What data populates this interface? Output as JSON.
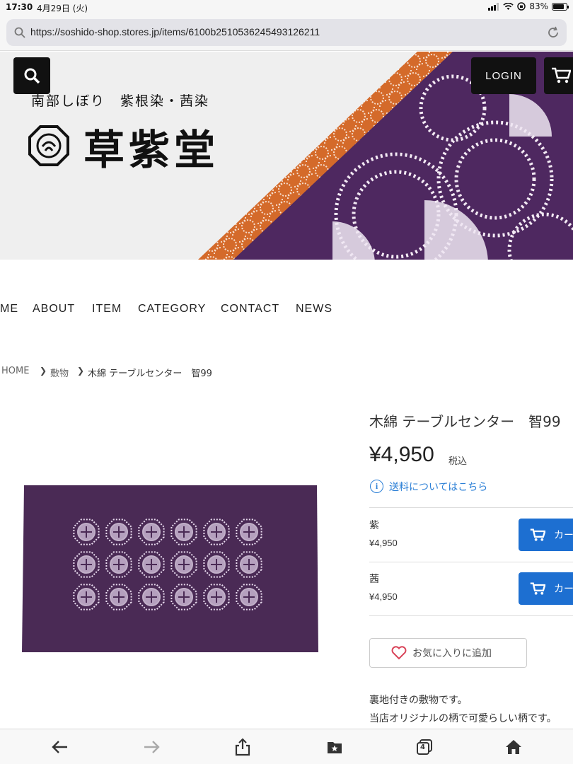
{
  "status": {
    "time": "17:30",
    "date": "4月29日 (火)",
    "battery": "83%"
  },
  "browser": {
    "url": "https://soshido-shop.stores.jp/items/6100b2510536245493126211"
  },
  "header": {
    "subtitle": "南部しぼり　紫根染・茜染",
    "shop_name": "草紫堂",
    "login_label": "LOGIN"
  },
  "nav": {
    "items": [
      "ME",
      "ABOUT",
      "ITEM",
      "CATEGORY",
      "CONTACT",
      "NEWS"
    ]
  },
  "breadcrumb": {
    "home": "HOME",
    "category": "敷物",
    "current": "木綿 テーブルセンター　智99"
  },
  "product": {
    "title": "木綿 テーブルセンター　智99",
    "price": "¥4,950",
    "tax_label": "税込",
    "shipping_link": "送料についてはこちら",
    "variants": [
      {
        "name": "紫",
        "price": "¥4,950",
        "button": "カー"
      },
      {
        "name": "茜",
        "price": "¥4,950",
        "button": "カー"
      }
    ],
    "favorite_label": "お気に入りに追加",
    "description": [
      "裏地付きの敷物です。",
      "当店オリジナルの柄で可愛らしい柄です。"
    ]
  },
  "toolbar": {
    "tabs_count": "4"
  },
  "colors": {
    "accent": "#1d6fd1",
    "link": "#2b7fd6",
    "fabric": "#4a2a55",
    "orange": "#d46a2a"
  }
}
